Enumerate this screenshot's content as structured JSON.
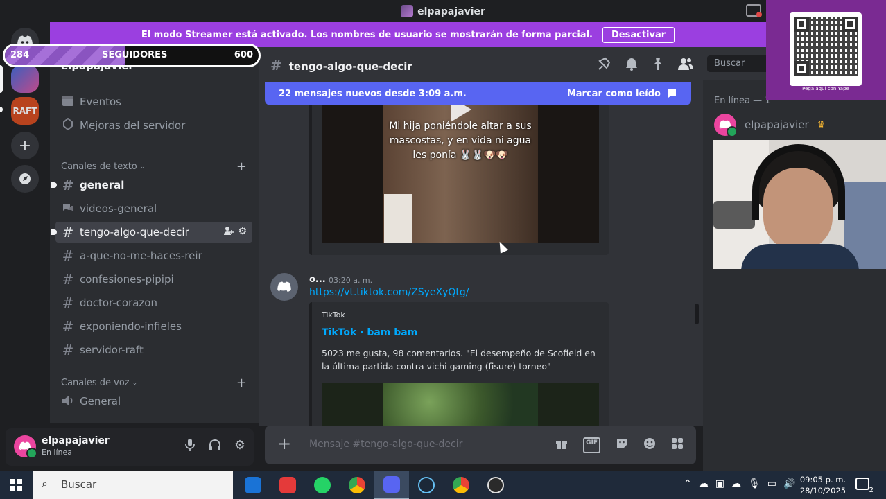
{
  "window": {
    "title": "elpapajavier"
  },
  "streamer_banner": {
    "text": "El modo Streamer está activado. Los nombres de usuario se mostrarán de forma parcial.",
    "button": "Desactivar"
  },
  "followers_bar": {
    "current": "284",
    "label": "SEGUIDORES",
    "goal": "600",
    "progress": 0.473
  },
  "rail": {
    "servers": [
      {
        "icon": "discord-icon"
      },
      {
        "icon": "server-avatar"
      },
      {
        "label": "RAFT"
      },
      {
        "icon": "plus-icon"
      },
      {
        "icon": "compass-icon"
      }
    ]
  },
  "sidebar": {
    "server_name": "elpapajavier",
    "items": [
      {
        "label": "Eventos",
        "icon": "calendar-icon"
      },
      {
        "label": "Mejoras del servidor",
        "icon": "boost-icon"
      }
    ],
    "text_category": "Canales de texto",
    "text_channels": [
      {
        "name": "general",
        "state": "unread"
      },
      {
        "name": "videos-general",
        "state": "normal"
      },
      {
        "name": "tengo-algo-que-decir",
        "state": "active"
      },
      {
        "name": "a-que-no-me-haces-reir",
        "state": "normal"
      },
      {
        "name": "confesiones-pipipi",
        "state": "normal"
      },
      {
        "name": "doctor-corazon",
        "state": "normal"
      },
      {
        "name": "exponiendo-infieles",
        "state": "normal"
      },
      {
        "name": "servidor-raft",
        "state": "normal"
      }
    ],
    "voice_category": "Canales de voz",
    "voice_channels": [
      {
        "name": "General"
      }
    ]
  },
  "user_panel": {
    "name": "elpapajavier",
    "status": "En línea"
  },
  "chat": {
    "channel": "tengo-algo-que-decir",
    "search_placeholder": "Buscar",
    "new_messages": "22 mensajes nuevos desde 3:09 a.m.",
    "mark_read": "Marcar como leído",
    "video_caption": "Mi hija poniéndole altar a sus mascostas, y en vida ni agua les ponía 🐰🐰🐶🐶",
    "message": {
      "author": "o...",
      "time": "03:20 a. m.",
      "link": "https://vt.tiktok.com/ZSyeXyQtg/",
      "embed_provider": "TikTok",
      "embed_title": "TikTok · bam bam",
      "embed_description": "5023 me gusta, 98 comentarios. \"El desempeño de Scofield en la última partida contra vichi gaming (fisure) torneo\""
    },
    "composer_placeholder": "Mensaje #tengo-algo-que-decir"
  },
  "members": {
    "header": "En línea — 1",
    "list": [
      {
        "name": "elpapajavier",
        "badge": "crown-icon"
      }
    ]
  },
  "qr_caption": "Pega aquí con Yape",
  "taskbar": {
    "search_placeholder": "Buscar",
    "time": "09:05 p. m.",
    "date": "28/10/2025",
    "notifications": "2"
  }
}
